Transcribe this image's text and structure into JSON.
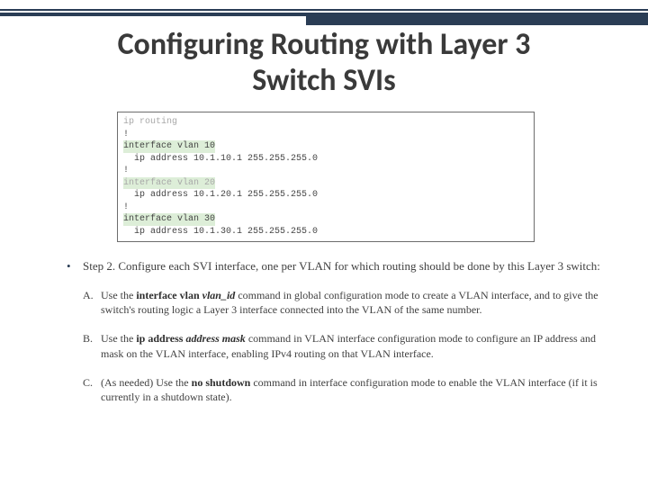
{
  "title_line1": "Configuring Routing with Layer 3",
  "title_line2": "Switch SVIs",
  "code": {
    "l1": "ip routing",
    "l2": "!",
    "l3a": "interface vlan 10",
    "l4": "  ip address 10.1.10.1 255.255.255.0",
    "l5": "!",
    "l6": "interface vlan 20",
    "l7": "  ip address 10.1.20.1 255.255.255.0",
    "l8": "!",
    "l9": "interface vlan 30",
    "l10": "  ip address 10.1.30.1 255.255.255.0"
  },
  "step_lead": "Step 2. Configure each SVI interface, one per VLAN for which routing should be done by this Layer 3 switch:",
  "sub_a_lbl": "A.",
  "sub_a_pre": "Use the ",
  "sub_a_cmd": "interface vlan ",
  "sub_a_arg": "vlan_id",
  "sub_a_post": " command in global configuration mode to create a VLAN interface, and to give the switch's routing logic a Layer 3 interface connected into the VLAN of the same number.",
  "sub_b_lbl": "B.",
  "sub_b_pre": "Use the ",
  "sub_b_cmd": "ip address ",
  "sub_b_arg": "address mask",
  "sub_b_post": " command in VLAN interface configuration mode to configure an IP address and mask on the VLAN interface, enabling IPv4 routing on that VLAN interface.",
  "sub_c_lbl": "C.",
  "sub_c_pre": "(As needed) Use the ",
  "sub_c_cmd": "no shutdown",
  "sub_c_post": " command in interface configuration mode to enable the VLAN interface (if it is currently in a shutdown state)."
}
